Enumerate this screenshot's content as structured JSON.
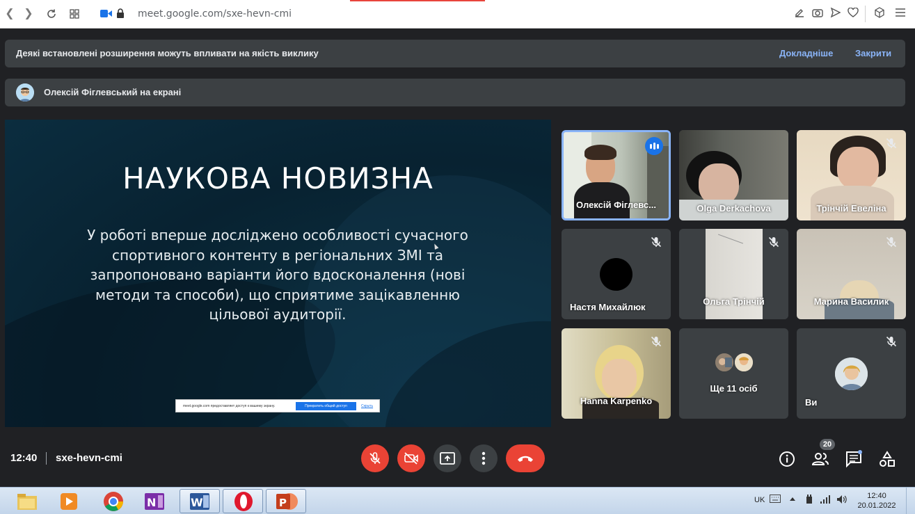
{
  "browser": {
    "url": "meet.google.com/sxe-hevn-cmi"
  },
  "extension_banner": {
    "message": "Деякі встановлені розширення можуть впливати на якість виклику",
    "learn_more": "Докладніше",
    "close": "Закрити"
  },
  "presenting_banner": {
    "message": "Олексій Фіглевський на екрані"
  },
  "slide": {
    "title": "НАУКОВА НОВИЗНА",
    "body": "У роботі вперше досліджено особливості сучасного спортивного контенту в регіональних ЗМІ та запропоновано варіанти його вдосконалення (нові методи та способи), що сприятиме зацікавленню цільової аудиторії.",
    "share_bar": {
      "message": "meet.google.com предоставляет доступ к вашему экрану.",
      "stop_button": "Прекратить общий доступ",
      "hide_link": "Скрыть"
    }
  },
  "participants": [
    {
      "name": "Олексій Фіглевс...",
      "muted": false,
      "speaking": true
    },
    {
      "name": "Olga Derkachova",
      "muted": false,
      "speaking": false
    },
    {
      "name": "Трінчій Евеліна",
      "muted": true,
      "speaking": false
    },
    {
      "name": "Настя Михайлюк",
      "muted": true,
      "speaking": false
    },
    {
      "name": "Ольга Трінчій",
      "muted": true,
      "speaking": false
    },
    {
      "name": "Марина Василик",
      "muted": true,
      "speaking": false
    },
    {
      "name": "Наnna Karpenko",
      "muted": true,
      "speaking": false
    },
    {
      "name": "Ще 11 осіб",
      "muted": false,
      "speaking": false
    },
    {
      "name": "Ви",
      "muted": true,
      "speaking": false
    }
  ],
  "meeting": {
    "time": "12:40",
    "code": "sxe-hevn-cmi",
    "participant_count": "20"
  },
  "colors": {
    "background": "#202124",
    "tile": "#3c4043",
    "danger": "#ea4335",
    "accent": "#8ab4f8",
    "speaking": "#1a73e8"
  },
  "taskbar": {
    "language": "UK",
    "clock_time": "12:40",
    "clock_date": "20.01.2022"
  }
}
